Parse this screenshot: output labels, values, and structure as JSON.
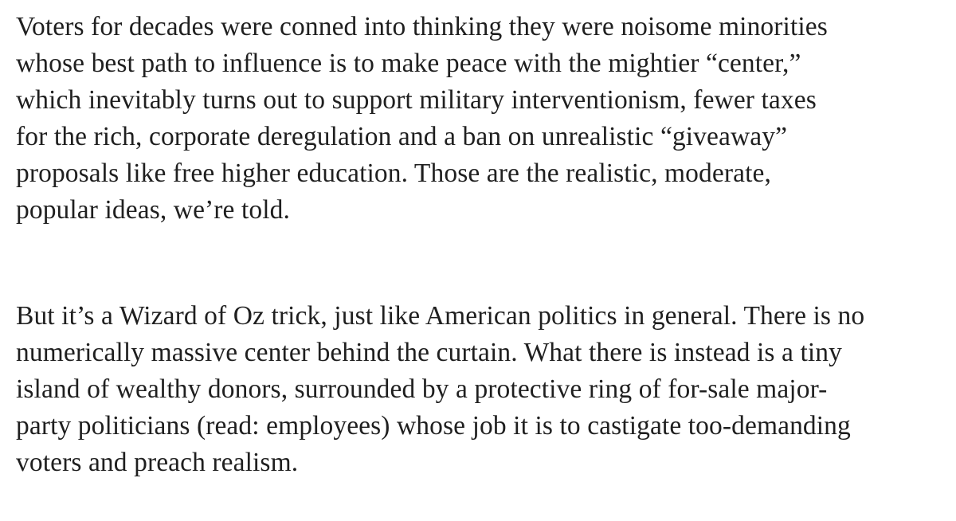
{
  "article": {
    "paragraphs": [
      {
        "lines": [
          "Voters for decades were conned into thinking they were noisome minorities",
          "whose best path to influence is to make peace with the mightier “center,”",
          "which inevitably turns out to support military interventionism, fewer taxes",
          "for the rich, corporate deregulation and a ban on unrealistic “giveaway”",
          "proposals like free higher education. Those are the realistic, moderate,",
          "popular ideas, we’re told."
        ]
      },
      {
        "lines": [
          "But it’s a Wizard of Oz trick, just like American politics in general. There is no",
          "numerically massive center behind the curtain. What there is instead is a tiny",
          "island of wealthy donors, surrounded by a protective ring of for-sale major-",
          "party politicians (read: employees) whose job it is to castigate too-demanding",
          "voters and preach realism."
        ]
      }
    ]
  }
}
